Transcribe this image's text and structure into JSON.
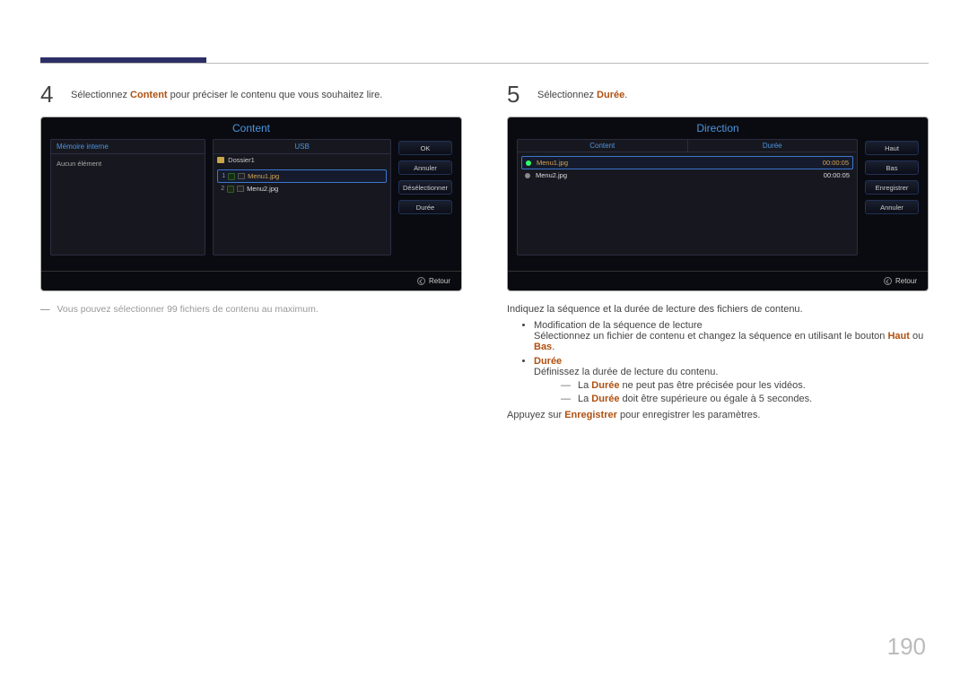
{
  "page_number": "190",
  "left": {
    "step_number": "4",
    "step_text_pre": "Sélectionnez ",
    "step_text_hl": "Content",
    "step_text_post": " pour préciser le contenu que vous souhaitez lire.",
    "note_pre": "Vous pouvez sélectionner 99 fichiers de contenu au maximum.",
    "panel": {
      "title": "Content",
      "left_tab": "Mémoire interne",
      "left_empty": "Aucun élément",
      "mid_tab": "USB",
      "folder_up": "Dossier1",
      "files": [
        {
          "idx": "1",
          "name": "Menu1.jpg",
          "selected": true
        },
        {
          "idx": "2",
          "name": "Menu2.jpg",
          "selected": false
        }
      ],
      "buttons": [
        "OK",
        "Annuler",
        "Désélectionner",
        "Durée"
      ],
      "retour": "Retour"
    }
  },
  "right": {
    "step_number": "5",
    "step_text_pre": "Sélectionnez ",
    "step_text_hl": "Durée",
    "step_text_post": ".",
    "panel": {
      "title": "Direction",
      "col1": "Content",
      "col2": "Durée",
      "rows": [
        {
          "name": "Menu1.jpg",
          "time": "00:00:05",
          "selected": true
        },
        {
          "name": "Menu2.jpg",
          "time": "00:00:05",
          "selected": false
        }
      ],
      "buttons": [
        "Haut",
        "Bas",
        "Enregistrer",
        "Annuler"
      ],
      "retour": "Retour"
    },
    "p1": "Indiquez la séquence et la durée de lecture des fichiers de contenu.",
    "bullet1": "Modification de la séquence de lecture",
    "bullet1_sub_pre": "Sélectionnez un fichier de contenu et changez la séquence en utilisant le bouton ",
    "bullet1_sub_hl1": "Haut",
    "bullet1_sub_mid": " ou ",
    "bullet1_sub_hl2": "Bas",
    "bullet1_sub_post": ".",
    "bullet2_hl": "Durée",
    "bullet2_sub": "Définissez la durée de lecture du contenu.",
    "bullet2_dash1_pre": "La ",
    "bullet2_dash1_hl": "Durée",
    "bullet2_dash1_post": " ne peut pas être précisée pour les vidéos.",
    "bullet2_dash2_pre": "La ",
    "bullet2_dash2_hl": "Durée",
    "bullet2_dash2_post": " doit être supérieure ou égale à 5 secondes.",
    "p2_pre": "Appuyez sur ",
    "p2_hl": "Enregistrer",
    "p2_post": " pour enregistrer les paramètres."
  }
}
